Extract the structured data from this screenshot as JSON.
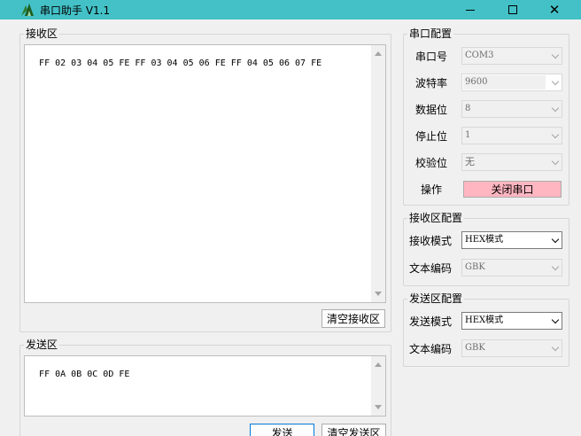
{
  "window": {
    "title": "串口助手 V1.1",
    "close_glyph": "✕"
  },
  "receive": {
    "group_title": "接收区",
    "content": "FF 02 03 04 05 FE FF 03 04 05 06 FE FF 04 05 06 07 FE",
    "clear_label": "清空接收区"
  },
  "send": {
    "group_title": "发送区",
    "content": "FF 0A 0B 0C 0D FE",
    "send_label": "发送",
    "clear_label": "清空发送区"
  },
  "serial_config": {
    "group_title": "串口配置",
    "port": {
      "label": "串口号",
      "value": "COM3"
    },
    "baud": {
      "label": "波特率",
      "value": "9600"
    },
    "databits": {
      "label": "数据位",
      "value": "8"
    },
    "stopbits": {
      "label": "停止位",
      "value": "1"
    },
    "parity": {
      "label": "校验位",
      "value": "无"
    },
    "action": {
      "label": "操作",
      "button": "关闭串口"
    }
  },
  "recv_config": {
    "group_title": "接收区配置",
    "mode": {
      "label": "接收模式",
      "value": "HEX模式"
    },
    "encoding": {
      "label": "文本编码",
      "value": "GBK"
    }
  },
  "send_config": {
    "group_title": "发送区配置",
    "mode": {
      "label": "发送模式",
      "value": "HEX模式"
    },
    "encoding": {
      "label": "文本编码",
      "value": "GBK"
    }
  },
  "colors": {
    "titlebar": "#43c1c7",
    "close_port_button": "#ffb6c1",
    "window_bg": "#f0f0f0"
  }
}
